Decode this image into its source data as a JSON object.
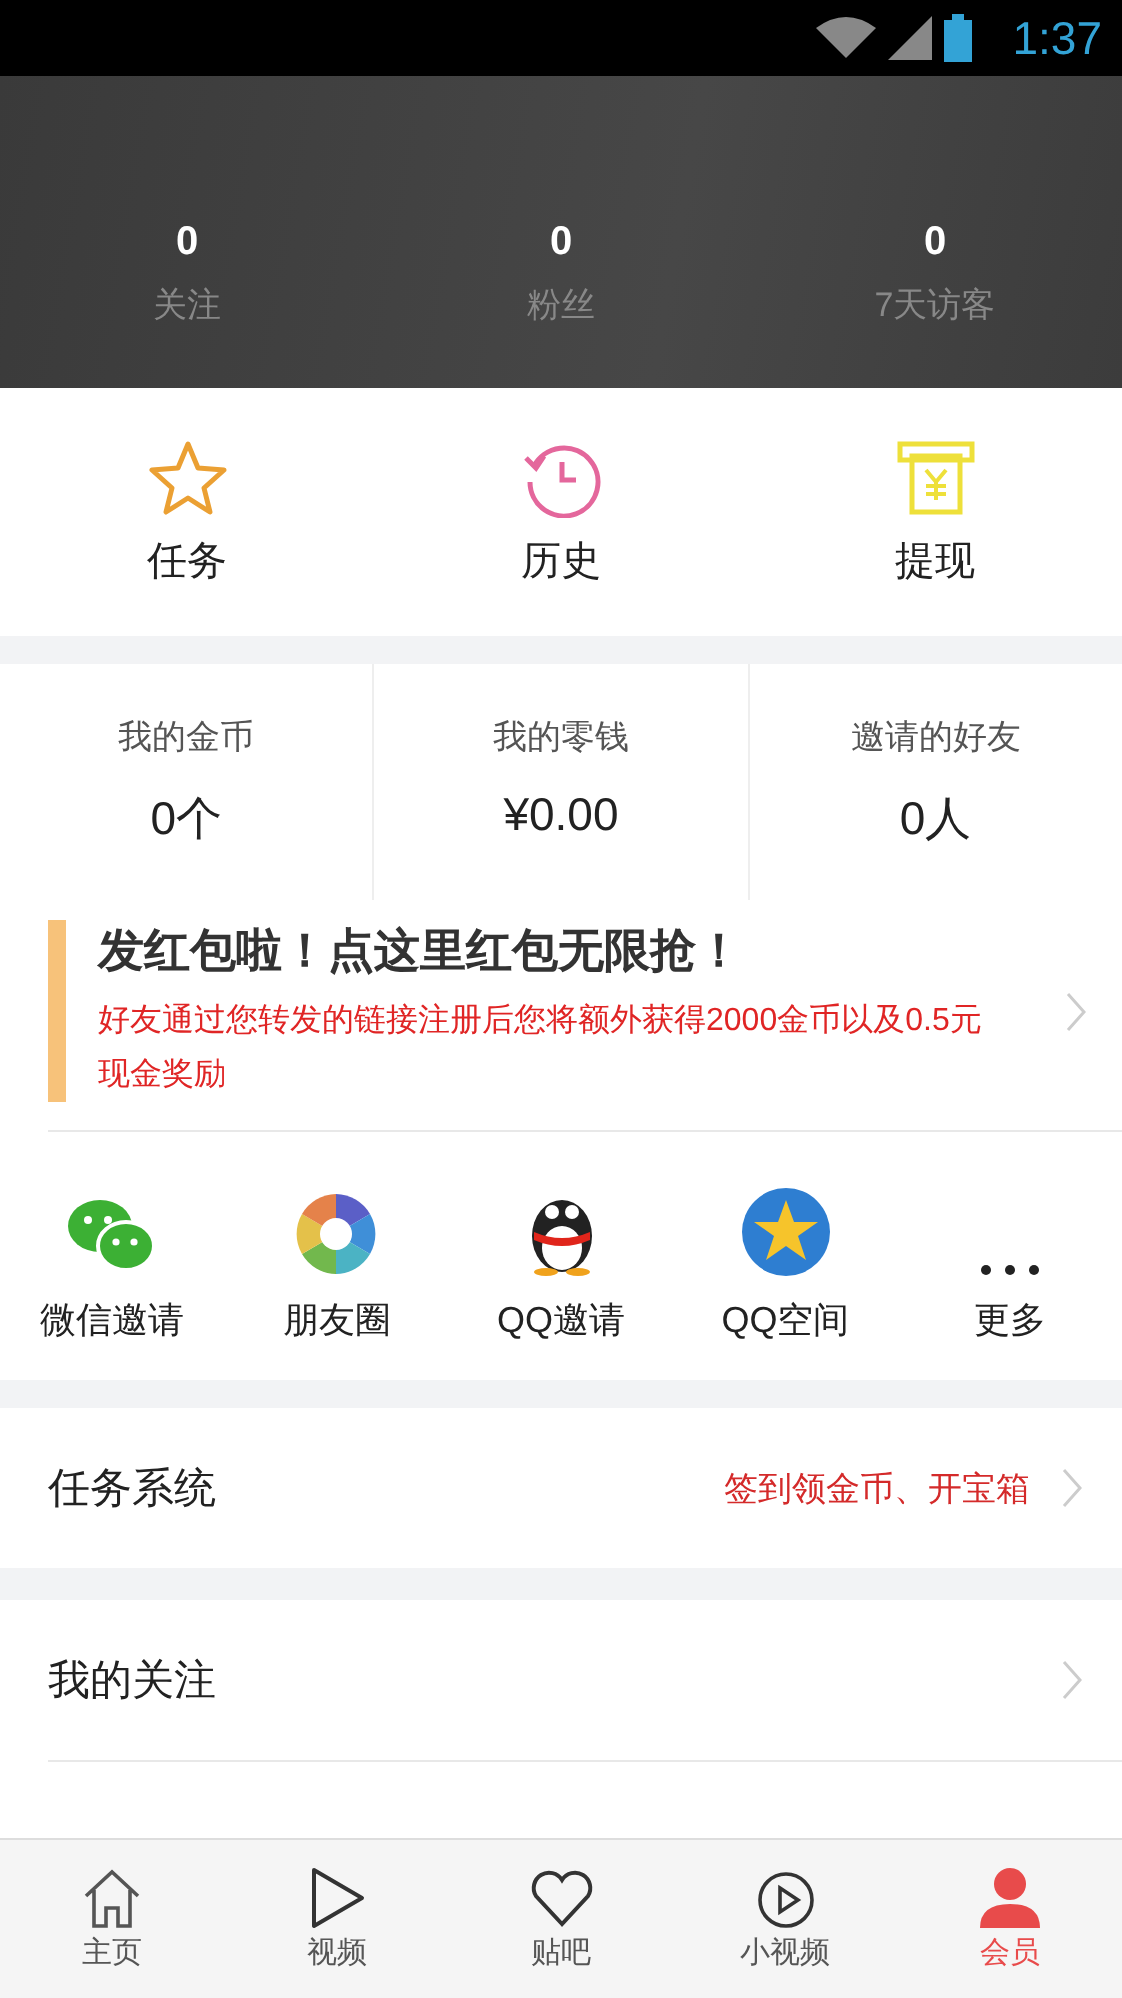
{
  "status_bar": {
    "time": "1:37"
  },
  "profile_stats": [
    {
      "value": "0",
      "label": "关注"
    },
    {
      "value": "0",
      "label": "粉丝"
    },
    {
      "value": "0",
      "label": "7天访客"
    }
  ],
  "quick_actions": [
    {
      "label": "任务"
    },
    {
      "label": "历史"
    },
    {
      "label": "提现"
    }
  ],
  "wallet": [
    {
      "label": "我的金币",
      "value": "0个"
    },
    {
      "label": "我的零钱",
      "value": "¥0.00"
    },
    {
      "label": "邀请的好友",
      "value": "0人"
    }
  ],
  "banner": {
    "title": "发红包啦！点这里红包无限抢！",
    "text": "好友通过您转发的链接注册后您将额外获得2000金币以及0.5元现金奖励"
  },
  "share": [
    {
      "label": "微信邀请"
    },
    {
      "label": "朋友圈"
    },
    {
      "label": "QQ邀请"
    },
    {
      "label": "QQ空间"
    },
    {
      "label": "更多"
    }
  ],
  "menu": [
    {
      "label": "任务系统",
      "hint": "签到领金币、开宝箱"
    },
    {
      "label": "我的关注"
    }
  ],
  "tab_bar": [
    {
      "label": "主页",
      "selected": false
    },
    {
      "label": "视频",
      "selected": false
    },
    {
      "label": "贴吧",
      "selected": false
    },
    {
      "label": "小视频",
      "selected": false
    },
    {
      "label": "会员",
      "selected": true
    }
  ]
}
